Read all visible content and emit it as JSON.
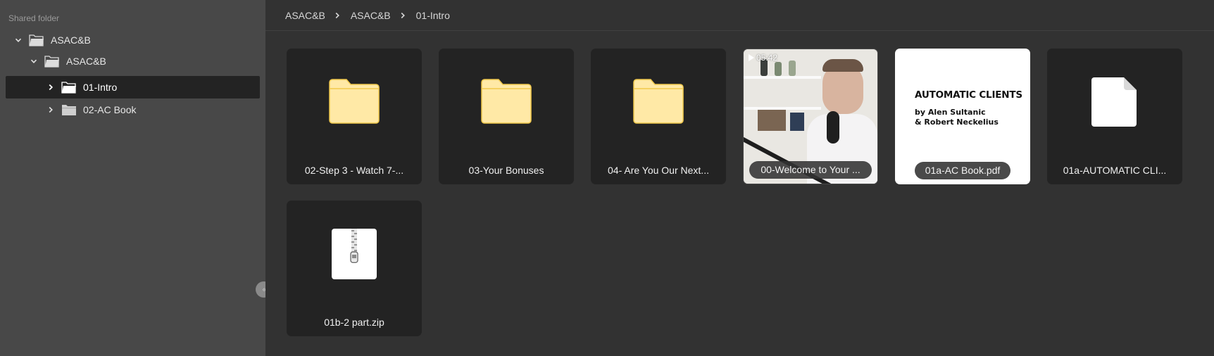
{
  "sidebar": {
    "heading": "Shared folder",
    "tree": [
      {
        "label": "ASAC&B",
        "expanded": true
      },
      {
        "label": "ASAC&B",
        "expanded": true
      },
      {
        "label": "01-Intro",
        "expanded": false,
        "selected": true
      },
      {
        "label": "02-AC Book",
        "expanded": false
      }
    ]
  },
  "breadcrumb": [
    "ASAC&B",
    "ASAC&B",
    "01-Intro"
  ],
  "items": [
    {
      "name": "02-Step 3 - Watch 7-...",
      "kind": "folder"
    },
    {
      "name": "03-Your Bonuses",
      "kind": "folder"
    },
    {
      "name": "04- Are You Our Next...",
      "kind": "folder"
    },
    {
      "name": "00-Welcome to Your ...",
      "kind": "video",
      "duration": "05:42"
    },
    {
      "name": "01a-AC Book.pdf",
      "kind": "pdf",
      "preview_title": "AUTOMATIC CLIENTS",
      "preview_line1": "by Alen Sultanic",
      "preview_line2": "& Robert Neckelius"
    },
    {
      "name": "01a-AUTOMATIC CLI...",
      "kind": "document"
    },
    {
      "name": "01b-2 part.zip",
      "kind": "zip"
    }
  ],
  "colors": {
    "folder_fill": "#FFE9A6",
    "folder_edge": "#F2C94C",
    "sidebar_bg": "#484848",
    "main_bg": "#323232",
    "tile_bg": "#232323"
  }
}
